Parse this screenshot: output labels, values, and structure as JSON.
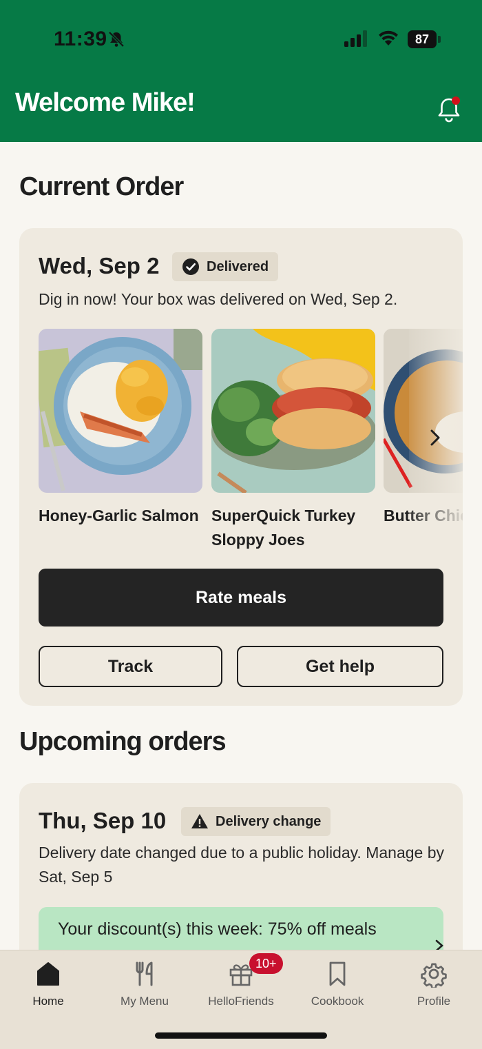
{
  "status_bar": {
    "time": "11:39",
    "battery": "87"
  },
  "header": {
    "title": "Welcome Mike!"
  },
  "current_order": {
    "section_title": "Current Order",
    "date": "Wed, Sep 2",
    "status": "Delivered",
    "message": "Dig in now! Your box was delivered on Wed, Sep 2.",
    "meals": [
      {
        "name": "Honey-Garlic Salmon"
      },
      {
        "name": "SuperQuick Turkey Sloppy Joes"
      },
      {
        "name": "Butter Chic"
      }
    ],
    "rate_label": "Rate meals",
    "track_label": "Track",
    "help_label": "Get help"
  },
  "upcoming": {
    "section_title": "Upcoming orders",
    "date": "Thu, Sep 10",
    "status": "Delivery change",
    "message": "Delivery date changed due to a public holiday. Manage by Sat, Sep 5",
    "discount": "Your discount(s) this week: 75% off meals"
  },
  "nav": {
    "home": "Home",
    "menu": "My Menu",
    "friends": "HelloFriends",
    "friends_badge": "10+",
    "cookbook": "Cookbook",
    "profile": "Profile"
  },
  "colors": {
    "brand_green": "#067a46",
    "card_bg": "#efeae0",
    "discount_bg": "#b9e6c3",
    "badge_red": "#c8102e"
  }
}
